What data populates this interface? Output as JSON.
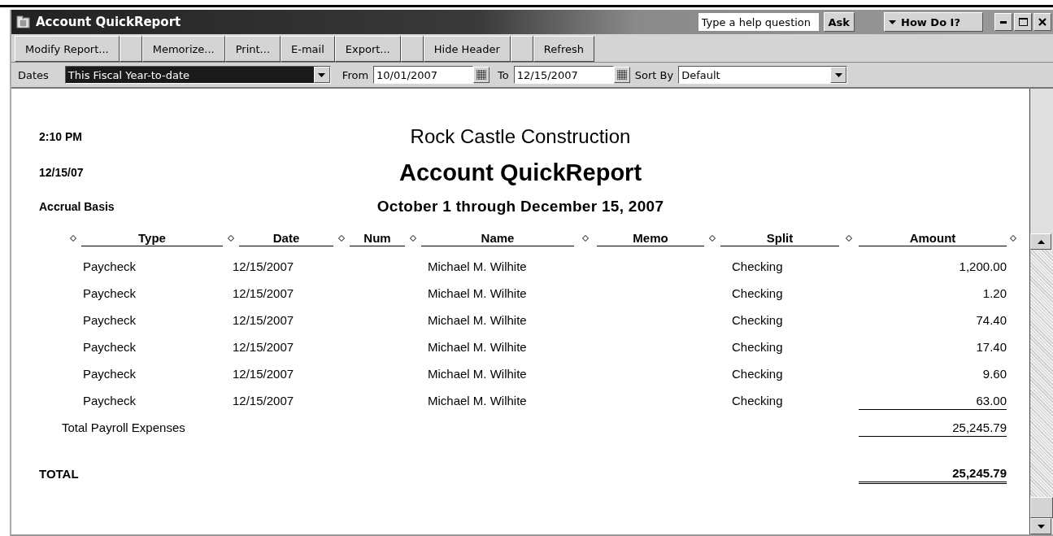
{
  "window": {
    "title": "Account QuickReport"
  },
  "help": {
    "placeholder": "Type a help question",
    "button": "Ask"
  },
  "how_do_i": "How Do I?",
  "toolbar": [
    {
      "kind": "button",
      "label": "Modify Report..."
    },
    {
      "kind": "spacer"
    },
    {
      "kind": "button",
      "label": "Memorize..."
    },
    {
      "kind": "button",
      "label": "Print..."
    },
    {
      "kind": "button",
      "label": "E-mail"
    },
    {
      "kind": "button",
      "label": "Export..."
    },
    {
      "kind": "spacer"
    },
    {
      "kind": "button",
      "label": "Hide Header"
    },
    {
      "kind": "spacer"
    },
    {
      "kind": "button",
      "label": "Refresh"
    }
  ],
  "filters": {
    "dates_label": "Dates",
    "dates_value": "This Fiscal Year-to-date",
    "from_label": "From",
    "from_value": "10/01/2007",
    "to_label": "To",
    "to_value": "12/15/2007",
    "sort_label": "Sort By",
    "sort_value": "Default"
  },
  "report": {
    "time": "2:10 PM",
    "date": "12/15/07",
    "basis": "Accrual Basis",
    "company": "Rock Castle Construction",
    "title": "Account QuickReport",
    "period": "October 1 through December 15, 2007",
    "columns": [
      "Type",
      "Date",
      "Num",
      "Name",
      "Memo",
      "Split",
      "Amount"
    ],
    "rows": [
      {
        "type": "Paycheck",
        "date": "12/15/2007",
        "name": "Michael M. Wilhite",
        "split": "Checking",
        "amount": "1,200.00"
      },
      {
        "type": "Paycheck",
        "date": "12/15/2007",
        "name": "Michael M. Wilhite",
        "split": "Checking",
        "amount": "1.20"
      },
      {
        "type": "Paycheck",
        "date": "12/15/2007",
        "name": "Michael M. Wilhite",
        "split": "Checking",
        "amount": "74.40"
      },
      {
        "type": "Paycheck",
        "date": "12/15/2007",
        "name": "Michael M. Wilhite",
        "split": "Checking",
        "amount": "17.40"
      },
      {
        "type": "Paycheck",
        "date": "12/15/2007",
        "name": "Michael M. Wilhite",
        "split": "Checking",
        "amount": "9.60"
      },
      {
        "type": "Paycheck",
        "date": "12/15/2007",
        "name": "Michael M. Wilhite",
        "split": "Checking",
        "amount": "63.00"
      }
    ],
    "subtotal": {
      "label": "Total Payroll Expenses",
      "amount": "25,245.79"
    },
    "total": {
      "label": "TOTAL",
      "amount": "25,245.79"
    }
  }
}
